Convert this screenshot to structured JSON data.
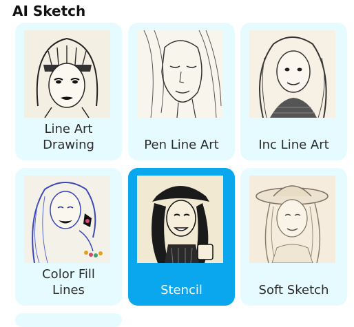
{
  "section": {
    "title": "AI Sketch"
  },
  "styles": [
    {
      "label": "Line Art Drawing",
      "label_line1": "Line Art",
      "label_line2": "Drawing",
      "selected": false
    },
    {
      "label": "Pen Line Art",
      "selected": false
    },
    {
      "label": "Inc Line Art",
      "selected": false
    },
    {
      "label": "Color Fill Lines",
      "label_line1": "Color Fill",
      "label_line2": "Lines",
      "selected": false
    },
    {
      "label": "Stencil",
      "selected": true
    },
    {
      "label": "Soft Sketch",
      "selected": false
    }
  ],
  "colors": {
    "card_bg": "#e6fbff",
    "selected_bg": "#0aa7ee",
    "selected_text": "#ffffff",
    "text": "#2b2b2b"
  }
}
